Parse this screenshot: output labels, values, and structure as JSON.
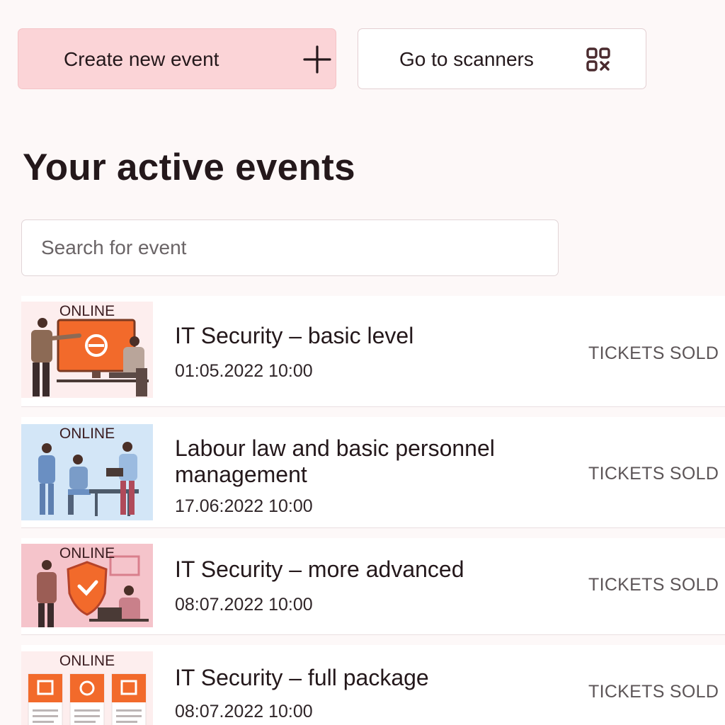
{
  "actions": {
    "create_label": "Create new event",
    "scanners_label": "Go to scanners"
  },
  "page_title": "Your active events",
  "search": {
    "placeholder": "Search for event",
    "value": ""
  },
  "events": [
    {
      "tag": "ONLINE",
      "title": "IT Security – basic level",
      "date": "01:05.2022 10:00",
      "tickets_label": "TICKETS SOLD"
    },
    {
      "tag": "ONLINE",
      "title": "Labour law and basic personnel management",
      "date": "17.06:2022 10:00",
      "tickets_label": "TICKETS SOLD"
    },
    {
      "tag": "ONLINE",
      "title": "IT Security – more advanced",
      "date": "08:07.2022 10:00",
      "tickets_label": "TICKETS SOLD"
    },
    {
      "tag": "ONLINE",
      "title": "IT Security – full package",
      "date": "08:07.2022 10:00",
      "tickets_label": "TICKETS SOLD"
    }
  ],
  "icons": {
    "create": "plus-icon",
    "scanners": "qr-code-icon"
  },
  "colors": {
    "primary_button_bg": "#fbd4d7",
    "accent_orange": "#f26a2b",
    "heading_text": "#24181b"
  }
}
